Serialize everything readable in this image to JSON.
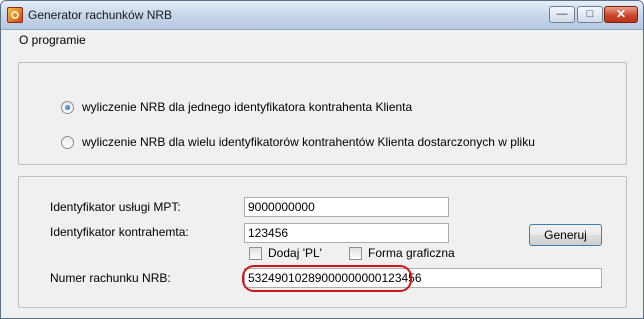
{
  "window": {
    "title": "Generator rachunków NRB",
    "controls": {
      "minimize": "—",
      "maximize": "□",
      "close": "✕"
    }
  },
  "menu": {
    "items": [
      {
        "label": "O programie"
      }
    ]
  },
  "mode_group": {
    "options": [
      {
        "label": "wyliczenie NRB dla jednego identyfikatora kontrahenta Klienta",
        "selected": true
      },
      {
        "label": "wyliczenie NRB dla wielu identyfikatorów kontrahentów Klienta dostarczonych w pliku",
        "selected": false
      }
    ]
  },
  "form": {
    "mpt_label": "Identyfikator usługi MPT:",
    "mpt_value": "9000000000",
    "contractor_label": "Identyfikator kontrahemta:",
    "contractor_value": "123456",
    "add_pl_label": "Dodaj 'PL'",
    "add_pl_checked": false,
    "graphic_label": "Forma graficzna",
    "graphic_checked": false,
    "nrb_label": "Numer rachunku NRB:",
    "nrb_value": "53249010289000000000123456",
    "generate_button": "Generuj"
  },
  "colors": {
    "highlight": "#d0161b",
    "button_border": "#3c7fb1"
  }
}
